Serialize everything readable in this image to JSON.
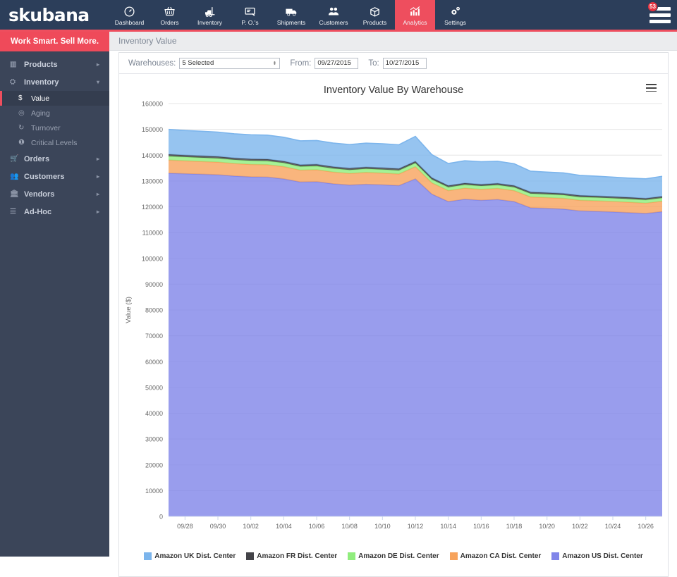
{
  "topnav": {
    "brand": "skubana",
    "items": [
      {
        "label": "Dashboard",
        "icon": "gauge-icon",
        "active": false
      },
      {
        "label": "Orders",
        "icon": "basket-icon",
        "active": false
      },
      {
        "label": "Inventory",
        "icon": "forklift-icon",
        "active": false
      },
      {
        "label": "P. O.'s",
        "icon": "purchase-order-icon",
        "active": false
      },
      {
        "label": "Shipments",
        "icon": "truck-icon",
        "active": false
      },
      {
        "label": "Customers",
        "icon": "people-icon",
        "active": false
      },
      {
        "label": "Products",
        "icon": "box-icon",
        "active": false
      },
      {
        "label": "Analytics",
        "icon": "bar-chart-icon",
        "active": true
      },
      {
        "label": "Settings",
        "icon": "gears-icon",
        "active": false
      }
    ],
    "notification_count": "53"
  },
  "sidebar": {
    "tagline": "Work Smart. Sell More.",
    "items": [
      {
        "label": "Products",
        "icon": "grid-icon",
        "caret": "▸",
        "type": "group"
      },
      {
        "label": "Inventory",
        "icon": "inventory-icon",
        "caret": "▾",
        "type": "group"
      },
      {
        "label": "Value",
        "icon": "dollar-icon",
        "type": "sub",
        "selected": true
      },
      {
        "label": "Aging",
        "icon": "clock-icon",
        "type": "sub",
        "selected": false
      },
      {
        "label": "Turnover",
        "icon": "refresh-icon",
        "type": "sub",
        "selected": false
      },
      {
        "label": "Critical Levels",
        "icon": "info-icon",
        "type": "sub",
        "selected": false
      },
      {
        "label": "Orders",
        "icon": "cart-icon",
        "caret": "▸",
        "type": "group"
      },
      {
        "label": "Customers",
        "icon": "customers-icon",
        "caret": "▸",
        "type": "group"
      },
      {
        "label": "Vendors",
        "icon": "vendor-icon",
        "caret": "▸",
        "type": "group"
      },
      {
        "label": "Ad-Hoc",
        "icon": "sliders-icon",
        "caret": "▸",
        "type": "group"
      }
    ]
  },
  "page": {
    "title": "Inventory Value"
  },
  "filters": {
    "warehouses_label": "Warehouses:",
    "warehouses_value": "5 Selected",
    "from_label": "From:",
    "from_value": "09/27/2015",
    "to_label": "To:",
    "to_value": "10/27/2015"
  },
  "chart_menu_icon": "hamburger-menu-icon",
  "colors": {
    "uk": "#7cb5ec",
    "fr": "#434348",
    "de": "#90ed7d",
    "ca": "#f7a35c",
    "us": "#8085e9",
    "accent": "#ee4e5e",
    "navy": "#2c3e5a",
    "sidebar": "#3b4559"
  },
  "chart_data": {
    "type": "area",
    "stacked": true,
    "title": "Inventory Value By Warehouse",
    "xlabel": "",
    "ylabel": "Value ($)",
    "ylim": [
      0,
      160000
    ],
    "ytick_step": 10000,
    "yticks": [
      0,
      10000,
      20000,
      30000,
      40000,
      50000,
      60000,
      70000,
      80000,
      90000,
      100000,
      110000,
      120000,
      130000,
      140000,
      150000,
      160000
    ],
    "grid": true,
    "legend_position": "bottom",
    "x": [
      "09/27",
      "09/28",
      "09/29",
      "09/30",
      "10/01",
      "10/02",
      "10/03",
      "10/04",
      "10/05",
      "10/06",
      "10/07",
      "10/08",
      "10/09",
      "10/10",
      "10/11",
      "10/12",
      "10/13",
      "10/14",
      "10/15",
      "10/16",
      "10/17",
      "10/18",
      "10/19",
      "10/20",
      "10/21",
      "10/22",
      "10/23",
      "10/24",
      "10/25",
      "10/26",
      "10/27"
    ],
    "xtick_labels": [
      "09/28",
      "09/30",
      "10/02",
      "10/04",
      "10/06",
      "10/08",
      "10/10",
      "10/12",
      "10/14",
      "10/16",
      "10/18",
      "10/20",
      "10/22",
      "10/24",
      "10/26"
    ],
    "series": [
      {
        "name": "Amazon US Dist. Center",
        "color": "#8085e9",
        "values": [
          133000,
          132800,
          132600,
          132400,
          131900,
          131600,
          131500,
          130800,
          129600,
          129700,
          128900,
          128400,
          128700,
          128500,
          128200,
          130800,
          124900,
          122000,
          122900,
          122500,
          122800,
          122000,
          119600,
          119400,
          119100,
          118400,
          118200,
          118000,
          117700,
          117400,
          118100
        ]
      },
      {
        "name": "Amazon CA Dist. Center",
        "color": "#f7a35c",
        "values": [
          5100,
          5000,
          4950,
          4900,
          4850,
          4800,
          4800,
          4750,
          4600,
          4650,
          4550,
          4500,
          4600,
          4550,
          4500,
          4700,
          4350,
          4250,
          4300,
          4250,
          4300,
          4250,
          4200,
          4150,
          4150,
          4100,
          4100,
          4050,
          4050,
          4000,
          4050
        ]
      },
      {
        "name": "Amazon DE Dist. Center",
        "color": "#90ed7d",
        "values": [
          1500,
          1480,
          1470,
          1460,
          1450,
          1440,
          1440,
          1430,
          1400,
          1410,
          1390,
          1380,
          1400,
          1390,
          1380,
          1420,
          1340,
          1310,
          1320,
          1310,
          1320,
          1310,
          1290,
          1280,
          1280,
          1270,
          1270,
          1260,
          1260,
          1250,
          1260
        ]
      },
      {
        "name": "Amazon FR Dist. Center",
        "color": "#434348",
        "values": [
          700,
          690,
          690,
          685,
          680,
          675,
          675,
          670,
          660,
          660,
          655,
          650,
          655,
          650,
          650,
          665,
          630,
          620,
          620,
          615,
          620,
          615,
          610,
          605,
          605,
          600,
          600,
          595,
          595,
          590,
          595
        ]
      },
      {
        "name": "Amazon UK Dist. Center",
        "color": "#7cb5ec",
        "values": [
          9700,
          9600,
          9550,
          9500,
          9400,
          9400,
          9350,
          9300,
          9300,
          9250,
          9200,
          9200,
          9300,
          9350,
          9300,
          9700,
          9000,
          8600,
          8700,
          8800,
          8600,
          8500,
          8100,
          8000,
          8000,
          7800,
          7700,
          7600,
          7500,
          7600,
          7800
        ]
      }
    ],
    "legend": [
      {
        "label": "Amazon UK Dist. Center",
        "color": "#7cb5ec"
      },
      {
        "label": "Amazon FR Dist. Center",
        "color": "#434348"
      },
      {
        "label": "Amazon DE Dist. Center",
        "color": "#90ed7d"
      },
      {
        "label": "Amazon CA Dist. Center",
        "color": "#f7a35c"
      },
      {
        "label": "Amazon US Dist. Center",
        "color": "#8085e9"
      }
    ]
  }
}
